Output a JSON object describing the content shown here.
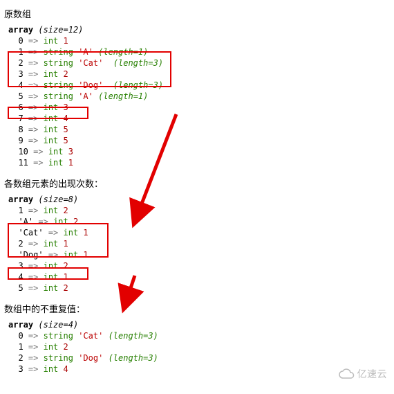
{
  "headings": {
    "h1": "原数组",
    "h2": "各数组元素的出现次数：",
    "h3": "数组中的不重复值："
  },
  "dump1": {
    "header": {
      "word": "array",
      "size_open": "(size=",
      "size_val": 12,
      "size_close": ")"
    },
    "rows": [
      {
        "key": "0",
        "arrow": "=>",
        "type": "int",
        "val": "1"
      },
      {
        "key": "1",
        "arrow": "=>",
        "type": "string",
        "val": "'A'",
        "len_label": "(length=",
        "len": 1,
        "len_close": ")"
      },
      {
        "key": "2",
        "arrow": "=>",
        "type": "string",
        "val": "'Cat'",
        "len_label": "(length=",
        "len": 3,
        "len_close": ")"
      },
      {
        "key": "3",
        "arrow": "=>",
        "type": "int",
        "val": "2"
      },
      {
        "key": "4",
        "arrow": "=>",
        "type": "string",
        "val": "'Dog'",
        "len_label": "(length=",
        "len": 3,
        "len_close": ")"
      },
      {
        "key": "5",
        "arrow": "=>",
        "type": "string",
        "val": "'A'",
        "len_label": "(length=",
        "len": 1,
        "len_close": ")"
      },
      {
        "key": "6",
        "arrow": "=>",
        "type": "int",
        "val": "3"
      },
      {
        "key": "7",
        "arrow": "=>",
        "type": "int",
        "val": "4"
      },
      {
        "key": "8",
        "arrow": "=>",
        "type": "int",
        "val": "5"
      },
      {
        "key": "9",
        "arrow": "=>",
        "type": "int",
        "val": "5"
      },
      {
        "key": "10",
        "arrow": "=>",
        "type": "int",
        "val": "3"
      },
      {
        "key": "11",
        "arrow": "=>",
        "type": "int",
        "val": "1"
      }
    ]
  },
  "dump2": {
    "header": {
      "word": "array",
      "size_open": "(size=",
      "size_val": 8,
      "size_close": ")"
    },
    "rows": [
      {
        "key": "1",
        "arrow": "=>",
        "type": "int",
        "val": "2"
      },
      {
        "key": "'A'",
        "arrow": "=>",
        "type": "int",
        "val": "2"
      },
      {
        "key": "'Cat'",
        "arrow": "=>",
        "type": "int",
        "val": "1"
      },
      {
        "key": "2",
        "arrow": "=>",
        "type": "int",
        "val": "1"
      },
      {
        "key": "'Dog'",
        "arrow": "=>",
        "type": "int",
        "val": "1"
      },
      {
        "key": "3",
        "arrow": "=>",
        "type": "int",
        "val": "2"
      },
      {
        "key": "4",
        "arrow": "=>",
        "type": "int",
        "val": "1"
      },
      {
        "key": "5",
        "arrow": "=>",
        "type": "int",
        "val": "2"
      }
    ]
  },
  "dump3": {
    "header": {
      "word": "array",
      "size_open": "(size=",
      "size_val": 4,
      "size_close": ")"
    },
    "rows": [
      {
        "key": "0",
        "arrow": "=>",
        "type": "string",
        "val": "'Cat'",
        "len_label": "(length=",
        "len": 3,
        "len_close": ")"
      },
      {
        "key": "1",
        "arrow": "=>",
        "type": "int",
        "val": "2"
      },
      {
        "key": "2",
        "arrow": "=>",
        "type": "string",
        "val": "'Dog'",
        "len_label": "(length=",
        "len": 3,
        "len_close": ")"
      },
      {
        "key": "3",
        "arrow": "=>",
        "type": "int",
        "val": "4"
      }
    ]
  },
  "watermark": "亿速云"
}
